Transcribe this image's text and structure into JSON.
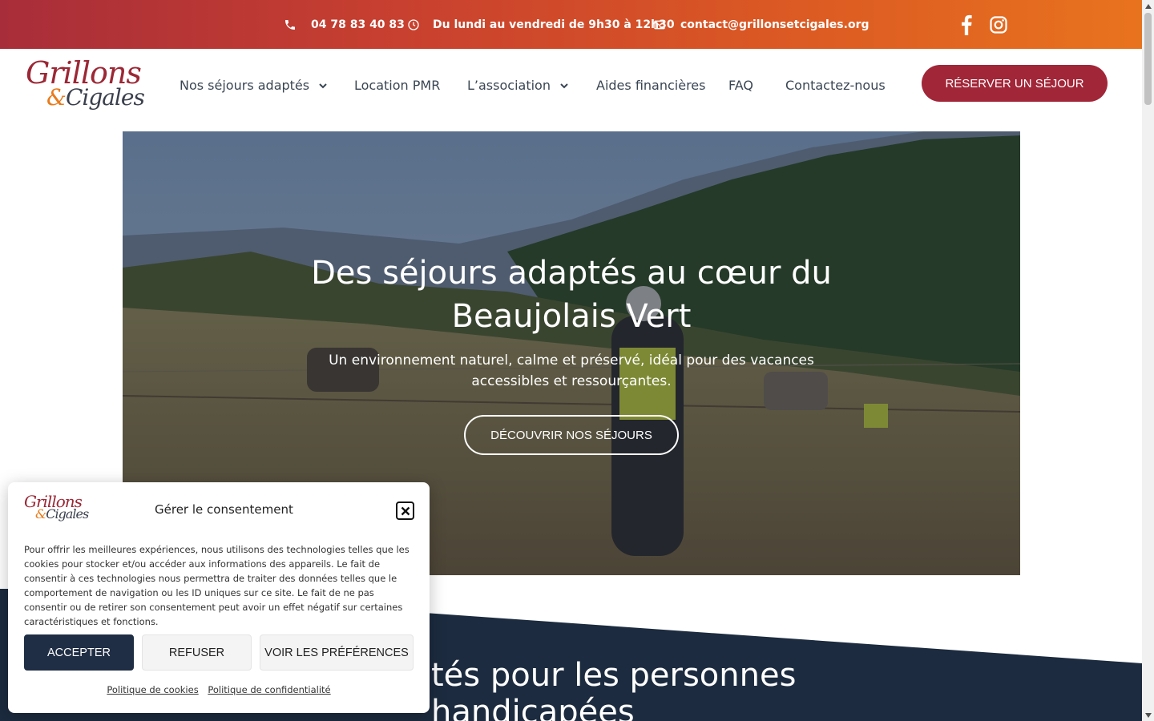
{
  "topbar": {
    "phone": "04 78 83 40 83",
    "hours": "Du lundi au vendredi de 9h30 à 12h30",
    "email": "contact@grillonsetcigales.org",
    "icons": [
      "phone-icon",
      "clock-icon",
      "envelope-icon",
      "facebook-icon",
      "instagram-icon"
    ]
  },
  "header": {
    "logo": {
      "line1": "Grillons",
      "amp": "&",
      "line2": "Cigales"
    },
    "nav": [
      {
        "label": "Nos séjours adaptés",
        "has_dropdown": true
      },
      {
        "label": "Location PMR",
        "has_dropdown": false
      },
      {
        "label": "L’association",
        "has_dropdown": true
      },
      {
        "label": "Aides financières",
        "has_dropdown": false
      },
      {
        "label": "FAQ",
        "has_dropdown": false
      },
      {
        "label": "Contactez-nous",
        "has_dropdown": false
      }
    ],
    "cta": "RÉSERVER UN SÉJOUR"
  },
  "hero": {
    "title_line1": "Des séjours adaptés au cœur du",
    "title_line2": "Beaujolais Vert",
    "subtitle_line1": "Un environnement naturel, calme et préservé, idéal pour des vacances",
    "subtitle_line2": "accessibles et ressourçantes.",
    "button": "DÉCOUVRIR NOS SÉJOURS"
  },
  "section": {
    "title": "tés pour les personnes handicapées"
  },
  "cookie": {
    "logo": {
      "line1": "Grillons",
      "amp": "&",
      "line2": "Cigales"
    },
    "title": "Gérer le consentement",
    "text": "Pour offrir les meilleures expériences, nous utilisons des technologies telles que les cookies pour stocker et/ou accéder aux informations des appareils. Le fait de consentir à ces technologies nous permettra de traiter des données telles que le comportement de navigation ou les ID uniques sur ce site. Le fait de ne pas consentir ou de retirer son consentement peut avoir un effet négatif sur certaines caractéristiques et fonctions.",
    "accept": "ACCEPTER",
    "refuse": "REFUSER",
    "preferences": "VOIR LES PRÉFÉRENCES",
    "link_cookies": "Politique de cookies",
    "link_privacy": "Politique de confidentialité"
  },
  "colors": {
    "brand_red": "#a12638",
    "brand_orange": "#e8731e",
    "dark_navy": "#1f2e45",
    "nav_text": "#3a4654"
  }
}
